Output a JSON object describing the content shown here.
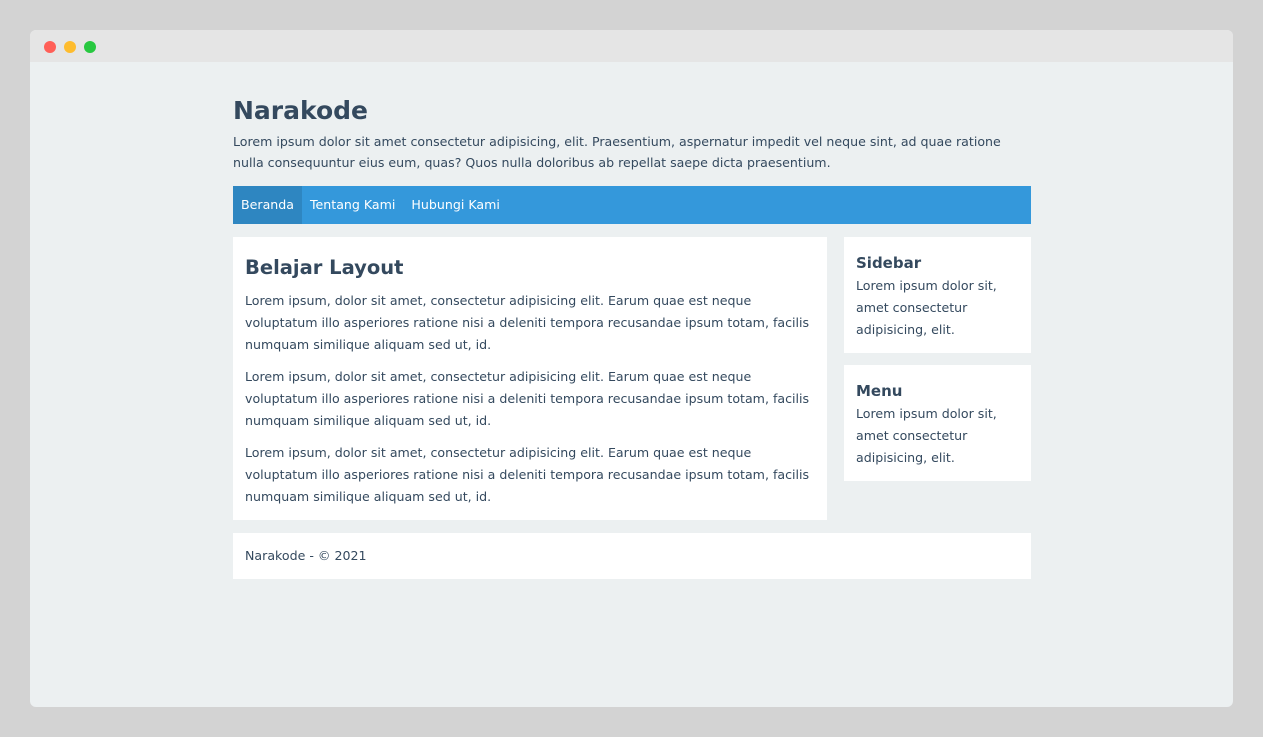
{
  "window": {
    "controls": [
      "close",
      "minimize",
      "maximize"
    ]
  },
  "header": {
    "title": "Narakode",
    "description": "Lorem ipsum dolor sit amet consectetur adipisicing, elit. Praesentium, aspernatur impedit vel neque sint, ad quae ratione nulla consequuntur eius eum, quas? Quos nulla doloribus ab repellat saepe dicta praesentium."
  },
  "nav": {
    "items": [
      {
        "label": "Beranda",
        "active": true
      },
      {
        "label": "Tentang Kami",
        "active": false
      },
      {
        "label": "Hubungi Kami",
        "active": false
      }
    ]
  },
  "main": {
    "title": "Belajar Layout",
    "paragraphs": [
      "Lorem ipsum, dolor sit amet, consectetur adipisicing elit. Earum quae est neque voluptatum illo asperiores ratione nisi a deleniti tempora recusandae ipsum totam, facilis numquam similique aliquam sed ut, id.",
      "Lorem ipsum, dolor sit amet, consectetur adipisicing elit. Earum quae est neque voluptatum illo asperiores ratione nisi a deleniti tempora recusandae ipsum totam, facilis numquam similique aliquam sed ut, id.",
      "Lorem ipsum, dolor sit amet, consectetur adipisicing elit. Earum quae est neque voluptatum illo asperiores ratione nisi a deleniti tempora recusandae ipsum totam, facilis numquam similique aliquam sed ut, id."
    ]
  },
  "sidebar": {
    "widgets": [
      {
        "title": "Sidebar",
        "text": "Lorem ipsum dolor sit, amet consectetur adipisicing, elit."
      },
      {
        "title": "Menu",
        "text": "Lorem ipsum dolor sit, amet consectetur adipisicing, elit."
      }
    ]
  },
  "footer": {
    "text": "Narakode - © 2021"
  },
  "colors": {
    "nav_bg": "#3498db",
    "nav_active": "#2e86c1",
    "text": "#34495e",
    "page_bg": "#ecf0f1"
  }
}
